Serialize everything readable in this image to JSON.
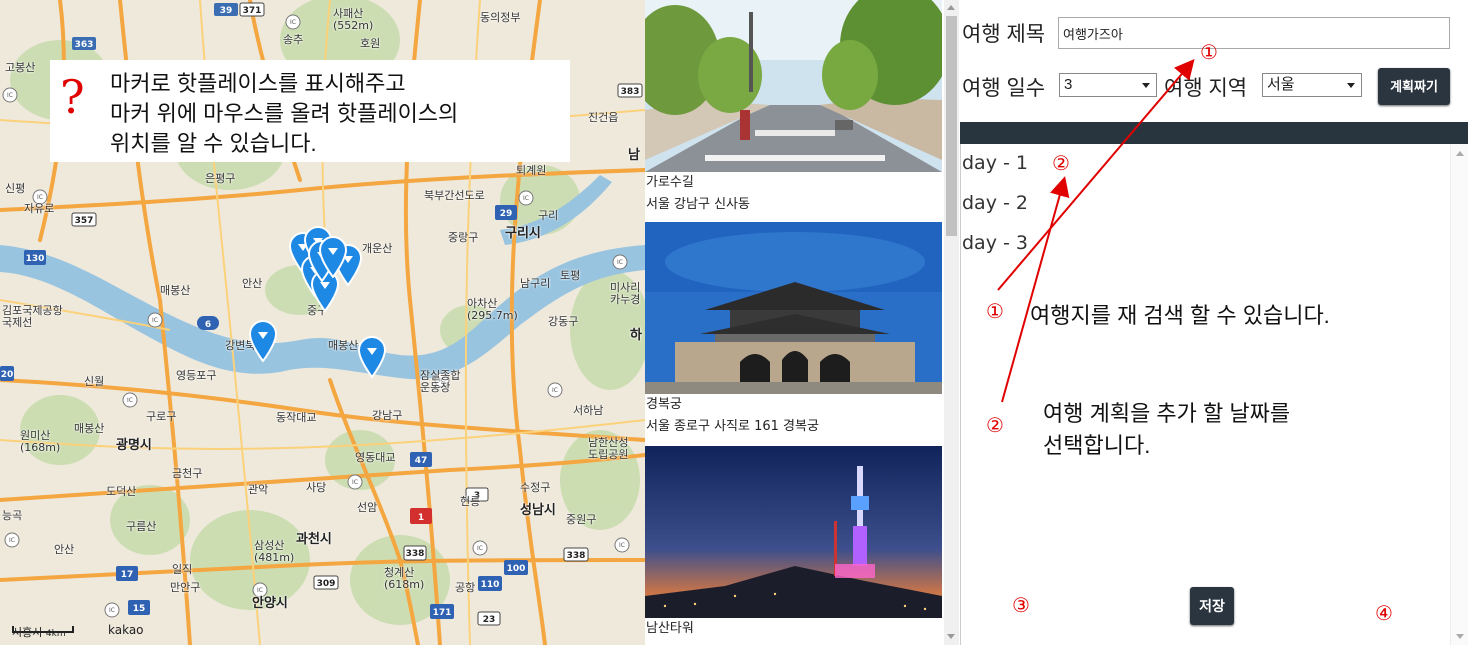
{
  "map": {
    "labels": [
      {
        "text": "사패산\n(552m)",
        "cls": ""
      },
      {
        "text": "동의정부",
        "cls": ""
      },
      {
        "text": "송추",
        "cls": ""
      },
      {
        "text": "호원",
        "cls": ""
      },
      {
        "text": "고봉산",
        "cls": ""
      },
      {
        "text": "은평구",
        "cls": ""
      },
      {
        "text": "신평",
        "cls": ""
      },
      {
        "text": "자유로",
        "cls": ""
      },
      {
        "text": "퇴계원",
        "cls": ""
      },
      {
        "text": "구리",
        "cls": ""
      },
      {
        "text": "구리시",
        "cls": "big"
      },
      {
        "text": "중랑구",
        "cls": ""
      },
      {
        "text": "개운산",
        "cls": ""
      },
      {
        "text": "안산",
        "cls": ""
      },
      {
        "text": "토평",
        "cls": ""
      },
      {
        "text": "남구리",
        "cls": ""
      },
      {
        "text": "아차산\n(295.7m)",
        "cls": ""
      },
      {
        "text": "미사리\n카누경",
        "cls": ""
      },
      {
        "text": "매봉산",
        "cls": ""
      },
      {
        "text": "김포국제공항\n국제선",
        "cls": ""
      },
      {
        "text": "강동구",
        "cls": ""
      },
      {
        "text": "하",
        "cls": "big"
      },
      {
        "text": "영등포구",
        "cls": ""
      },
      {
        "text": "신월",
        "cls": ""
      },
      {
        "text": "잠실종합\n운동장",
        "cls": ""
      },
      {
        "text": "서하남",
        "cls": ""
      },
      {
        "text": "구로구",
        "cls": ""
      },
      {
        "text": "강남구",
        "cls": ""
      },
      {
        "text": "매봉산",
        "cls": ""
      },
      {
        "text": "원미산\n(168m)",
        "cls": ""
      },
      {
        "text": "광명시",
        "cls": "big"
      },
      {
        "text": "남한산성\n도립공원",
        "cls": ""
      },
      {
        "text": "금천구",
        "cls": ""
      },
      {
        "text": "관악",
        "cls": ""
      },
      {
        "text": "선암",
        "cls": ""
      },
      {
        "text": "수정구",
        "cls": ""
      },
      {
        "text": "성남시",
        "cls": "big"
      },
      {
        "text": "도덕산",
        "cls": ""
      },
      {
        "text": "구름산",
        "cls": ""
      },
      {
        "text": "중원구",
        "cls": ""
      },
      {
        "text": "과천시",
        "cls": "big"
      },
      {
        "text": "삼성산\n(481m)",
        "cls": ""
      },
      {
        "text": "청계산\n(618m)",
        "cls": ""
      },
      {
        "text": "안산",
        "cls": ""
      },
      {
        "text": "일직",
        "cls": ""
      },
      {
        "text": "만안구",
        "cls": ""
      },
      {
        "text": "안양시",
        "cls": "big"
      },
      {
        "text": "진건읍",
        "cls": ""
      },
      {
        "text": "남",
        "cls": "big"
      },
      {
        "text": "사당",
        "cls": ""
      },
      {
        "text": "매봉산",
        "cls": ""
      },
      {
        "text": "중구",
        "cls": ""
      },
      {
        "text": "동작대교",
        "cls": ""
      },
      {
        "text": "영동대교",
        "cls": ""
      },
      {
        "text": "능곡",
        "cls": ""
      },
      {
        "text": "현릉",
        "cls": ""
      },
      {
        "text": "공항",
        "cls": ""
      },
      {
        "text": "북부간선도로",
        "cls": ""
      },
      {
        "text": "강변북로",
        "cls": ""
      }
    ],
    "scale_label": "4km",
    "scale_city": "시흥시",
    "kakao_label": "kakao",
    "markers": 9
  },
  "map_note": {
    "line1": "마커로 핫플레이스를 표시해주고",
    "line2": "마커 위에 마우스를 올려 핫플레이스의",
    "line3": "위치를 알 수 있습니다.",
    "qmark": "?"
  },
  "places": [
    {
      "name": "가로수길",
      "address": "서울 강남구 신사동"
    },
    {
      "name": "경복궁",
      "address": "서울 종로구 사직로 161 경복궁"
    },
    {
      "name": "남산타워",
      "address": ""
    }
  ],
  "planner": {
    "title_label": "여행 제목",
    "title_value": "여행가즈아",
    "days_label": "여행 일수",
    "days_value": "3",
    "region_label": "여행 지역",
    "region_value": "서울",
    "plan_button": "계획짜기",
    "days": [
      "day - 1",
      "day - 2",
      "day - 3"
    ],
    "save_button": "저장"
  },
  "annotations": {
    "c1": "①",
    "c2": "②",
    "c3": "③",
    "c4": "④",
    "note1": "여행지를 재 검색 할 수 있습니다.",
    "note2_line1": "여행 계획을 추가 할 날짜를",
    "note2_line2": "선택합니다."
  },
  "colors": {
    "accent_red": "#e00000",
    "dark_bar": "#28353f",
    "marker_blue": "#1e88e5"
  }
}
